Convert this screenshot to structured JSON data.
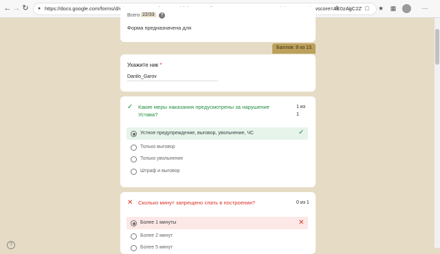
{
  "browser": {
    "url": "https://docs.google.com/forms/d/e/1FAIpQLSe1xqfWOA...Kjrfcf.JTuuUXdfN5omDos-1Jye71VPgKUKFg/viewscore?viewscore=AE0zAgC2ZYKlbltWvje...",
    "icons": [
      "back-icon",
      "forward-icon",
      "reload-icon",
      "lock-icon",
      "reader-mode-icon",
      "favorite-icon",
      "extensions-icon",
      "collections-icon",
      "profile-icon",
      "menu-icon"
    ]
  },
  "top_card": {
    "partial_label": "Всего",
    "partial_badge": "22/33",
    "description": "Форма предназначена для"
  },
  "score_badge": "Баллов: 8 из 13.",
  "nick": {
    "label": "Укажите ник",
    "required_mark": "*",
    "value": "Danilo_Garov"
  },
  "q1": {
    "question": "Какие меры наказания предусмотрены за нарушение Устава?",
    "score_line1": "1 из",
    "score_line2": "1",
    "status": "correct",
    "options": [
      {
        "label": "Устное предупреждение, выговор, увольнение, ЧС",
        "selected": true
      },
      {
        "label": "Только выговор",
        "selected": false
      },
      {
        "label": "Только увольнение",
        "selected": false
      },
      {
        "label": "Штраф и выговор",
        "selected": false
      }
    ]
  },
  "q2": {
    "question": "Сколько минут запрещено спать в построении?",
    "score": "0 из 1",
    "status": "incorrect",
    "options": [
      {
        "label": "Более 1 минуты",
        "selected": true
      },
      {
        "label": "Более 2 минут",
        "selected": false
      },
      {
        "label": "Более 5 минут",
        "selected": false
      }
    ]
  },
  "colors": {
    "page_bg": "#e6dcc6",
    "accent": "#bca15c",
    "correct": "#1e8e3e",
    "correct_bg": "#e6f4ea",
    "incorrect": "#d93025",
    "incorrect_bg": "#fce8e6"
  }
}
